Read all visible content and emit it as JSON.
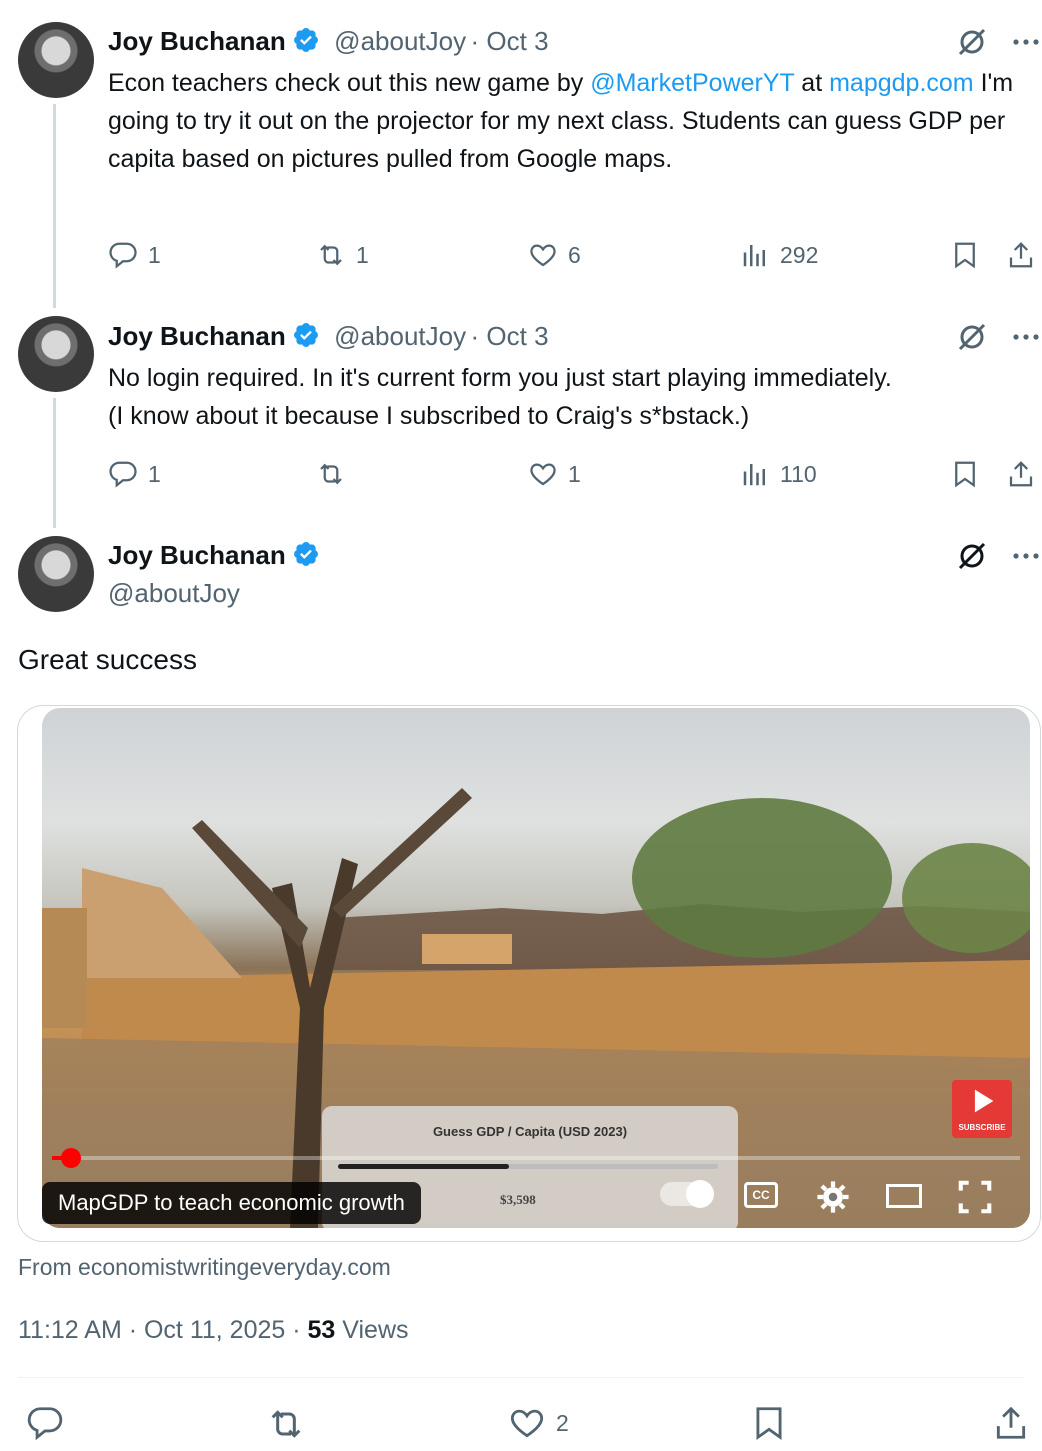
{
  "tweets": [
    {
      "name": "Joy Buchanan",
      "handle": "@aboutJoy",
      "date": "· Oct 3",
      "text_parts": [
        "Econ teachers check out this new game by ",
        "@MarketPowerYT",
        " at ",
        "mapgdp.com",
        " I'm going to try it out on the projector for my next class. Students can guess GDP per capita based on pictures pulled from Google maps."
      ],
      "replies": "1",
      "reposts": "1",
      "likes": "6",
      "views": "292"
    },
    {
      "name": "Joy Buchanan",
      "handle": "@aboutJoy",
      "date": "· Oct 3",
      "line1": "No login required. In it's current form you just start playing immediately.",
      "line2": "(I know about it because I subscribed to Craig's s*bstack.)",
      "replies": "1",
      "reposts": "",
      "likes": "1",
      "views": "110"
    }
  ],
  "main_tweet": {
    "name": "Joy Buchanan",
    "handle": "@aboutJoy",
    "text": "Great success",
    "video": {
      "caption": "MapGDP to teach economic growth",
      "overlay_title": "Guess GDP / Capita (USD 2023)",
      "overlay_value": "$3,598",
      "subscribe_label": "SUBSCRIBE",
      "cc_label": "CC",
      "progress": 0.02,
      "slider_fraction": 0.45
    },
    "source": "From economistwritingeveryday.com",
    "time": "11:12 AM · Oct 11, 2025 · ",
    "views_count": "53",
    "views_label": " Views",
    "likes": "2"
  },
  "colors": {
    "accent": "#1d9bf0",
    "muted": "#536471",
    "verified": "#1d9bf0"
  }
}
